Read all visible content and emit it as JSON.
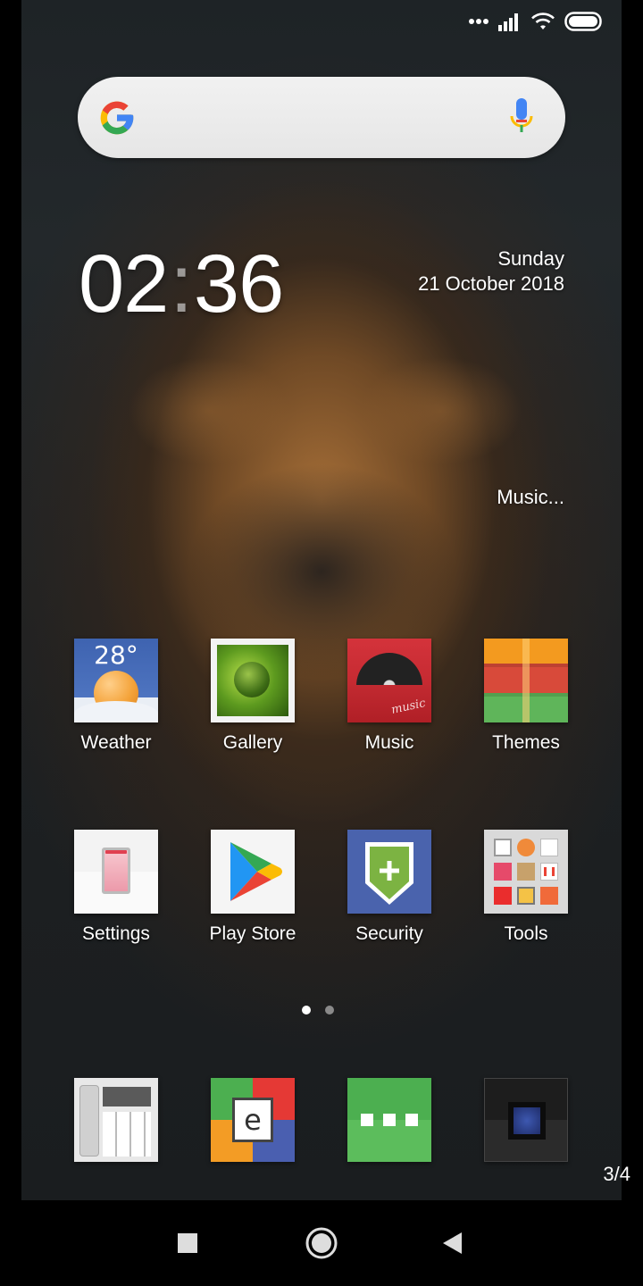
{
  "status_bar": {
    "icons": [
      "more-dots-icon",
      "signal-icon",
      "wifi-icon",
      "battery-icon"
    ]
  },
  "search": {
    "icons": [
      "google-g-icon",
      "microphone-icon"
    ]
  },
  "clock_widget": {
    "hours": "02",
    "separator": ":",
    "minutes": "36",
    "weekday": "Sunday",
    "date": "21 October 2018"
  },
  "music_widget": {
    "label": "Music..."
  },
  "apps_row1": [
    {
      "label": "Weather",
      "temperature": "28°"
    },
    {
      "label": "Gallery"
    },
    {
      "label": "Music",
      "icon_text": "music"
    },
    {
      "label": "Themes"
    }
  ],
  "apps_row2": [
    {
      "label": "Settings"
    },
    {
      "label": "Play Store"
    },
    {
      "label": "Security"
    },
    {
      "label": "Tools"
    }
  ],
  "page_indicator": {
    "pages": 2,
    "active": 1,
    "active_color": "#ffffff",
    "inactive_color": "#8a8a8a"
  },
  "dock": {
    "icons": [
      "phone-app-icon",
      "browser-app-icon",
      "messaging-app-icon",
      "camera-app-icon"
    ]
  },
  "page_counter": "3/4",
  "nav_bar": {
    "icons": [
      "recent-apps-icon",
      "home-icon",
      "back-icon"
    ]
  },
  "colors": {
    "google_blue": "#4285f4",
    "google_red": "#ea4335",
    "google_yellow": "#fbbc05",
    "google_green": "#34a853"
  }
}
